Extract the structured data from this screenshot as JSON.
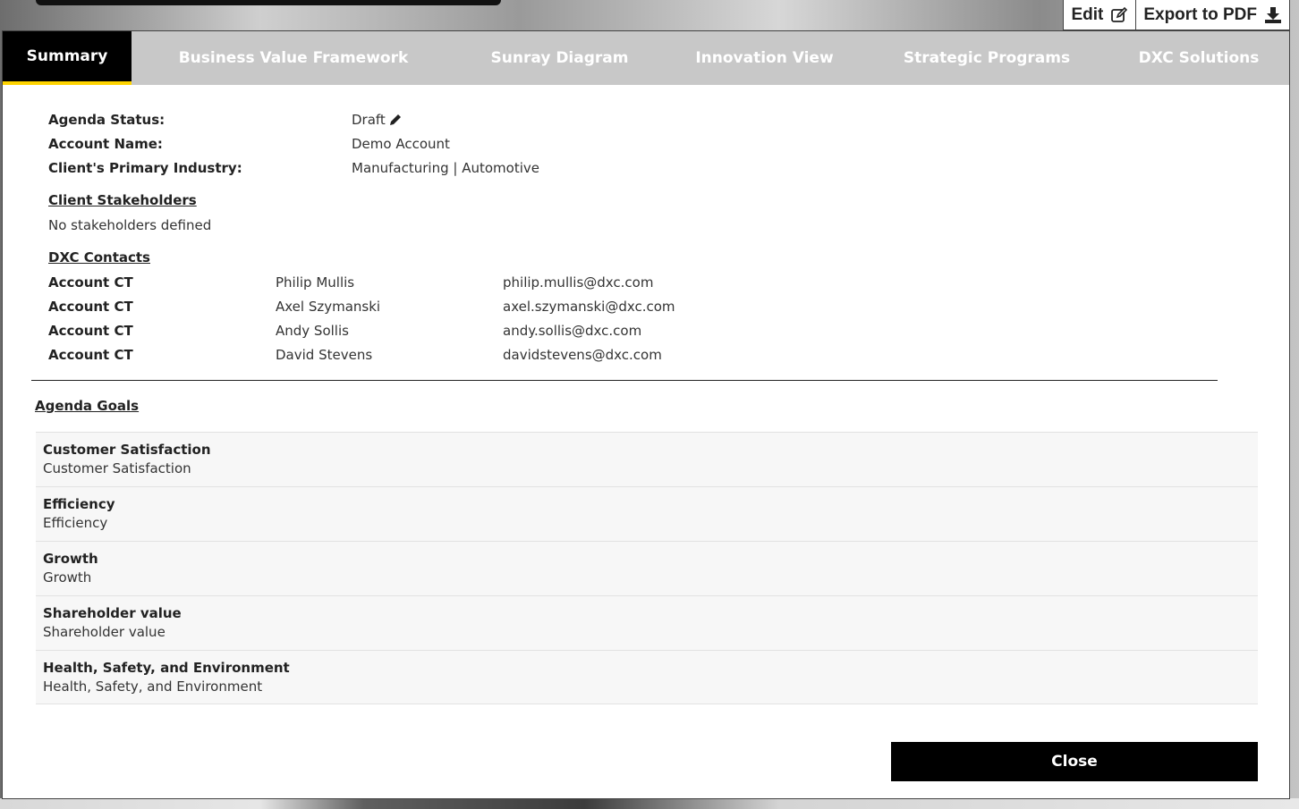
{
  "toolbar": {
    "edit_label": "Edit",
    "export_label": "Export to PDF"
  },
  "tabs": [
    {
      "label": "Summary",
      "active": true
    },
    {
      "label": "Business Value Framework",
      "active": false
    },
    {
      "label": "Sunray Diagram",
      "active": false
    },
    {
      "label": "Innovation View",
      "active": false
    },
    {
      "label": "Strategic Programs",
      "active": false
    },
    {
      "label": "DXC Solutions",
      "active": false
    }
  ],
  "summary": {
    "agenda_status_label": "Agenda Status:",
    "agenda_status_value": "Draft",
    "account_name_label": "Account Name:",
    "account_name_value": "Demo Account",
    "industry_label": "Client's Primary Industry:",
    "industry_value": "Manufacturing | Automotive"
  },
  "stakeholders": {
    "heading": "Client Stakeholders",
    "empty_text": "No stakeholders defined"
  },
  "contacts": {
    "heading": "DXC Contacts",
    "rows": [
      {
        "role": "Account CT",
        "name": "Philip Mullis",
        "email": "philip.mullis@dxc.com"
      },
      {
        "role": "Account CT",
        "name": "Axel Szymanski",
        "email": "axel.szymanski@dxc.com"
      },
      {
        "role": "Account CT",
        "name": "Andy Sollis",
        "email": "andy.sollis@dxc.com"
      },
      {
        "role": "Account CT",
        "name": "David Stevens",
        "email": "davidstevens@dxc.com"
      }
    ]
  },
  "goals": {
    "heading": "Agenda Goals",
    "items": [
      {
        "title": "Customer Satisfaction",
        "description": "Customer Satisfaction"
      },
      {
        "title": "Efficiency",
        "description": "Efficiency"
      },
      {
        "title": "Growth",
        "description": "Growth"
      },
      {
        "title": "Shareholder value",
        "description": "Shareholder value"
      },
      {
        "title": "Health, Safety, and Environment",
        "description": "Health, Safety, and Environment"
      }
    ]
  },
  "footer": {
    "close_label": "Close"
  },
  "colors": {
    "tab_active_bg": "#000000",
    "tab_active_underline": "#ffd400",
    "tab_bar_bg": "#c8c8c8"
  },
  "icons": {
    "edit": "edit-square-icon",
    "export": "download-icon",
    "status_edit": "pencil-icon"
  }
}
